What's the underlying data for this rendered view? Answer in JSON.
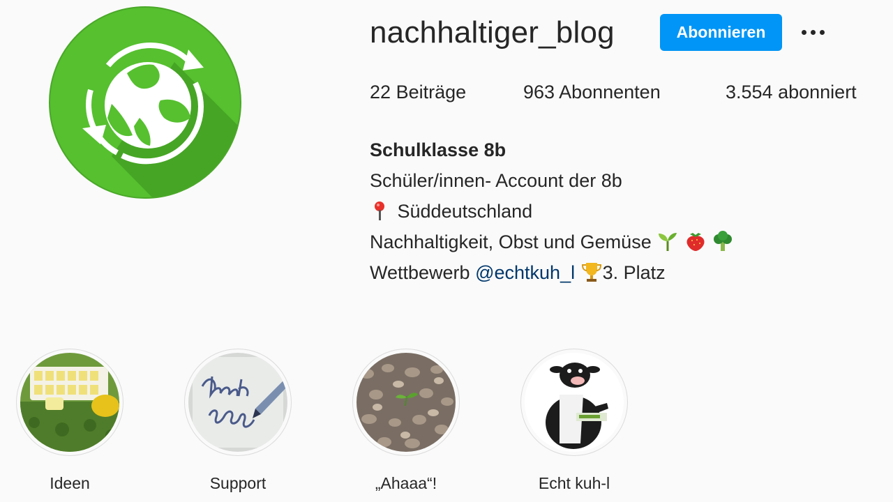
{
  "profile": {
    "username": "nachhaltiger_blog",
    "follow_label": "Abonnieren",
    "more_label": "Optionen",
    "avatar_color": "#56c02f"
  },
  "stats": {
    "posts_num": "22",
    "posts_label": "Beiträge",
    "followers_num": "963",
    "followers_label": "Abonnenten",
    "following_num": "3.554",
    "following_label": "abonniert"
  },
  "bio": {
    "name": "Schulklasse 8b",
    "line1": "Schüler/innen- Account der 8b",
    "line2": "Süddeutschland",
    "line3": "Nachhaltigkeit, Obst und Gemüse",
    "line4_prefix": "Wettbewerb",
    "line4_mention": "@echtkuh_l",
    "line4_suffix": "3. Platz",
    "icons": [
      "round-pushpin-icon",
      "seedling-icon",
      "strawberry-icon",
      "broccoli-icon",
      "trophy-icon"
    ]
  },
  "highlights": [
    {
      "label": "Ideen"
    },
    {
      "label": "Support"
    },
    {
      "label": "„Ahaaa“!"
    },
    {
      "label": "Echt kuh-l"
    }
  ],
  "colors": {
    "accent": "#0095f6",
    "mention": "#00376b",
    "text": "#262626",
    "background": "#fafafa"
  }
}
